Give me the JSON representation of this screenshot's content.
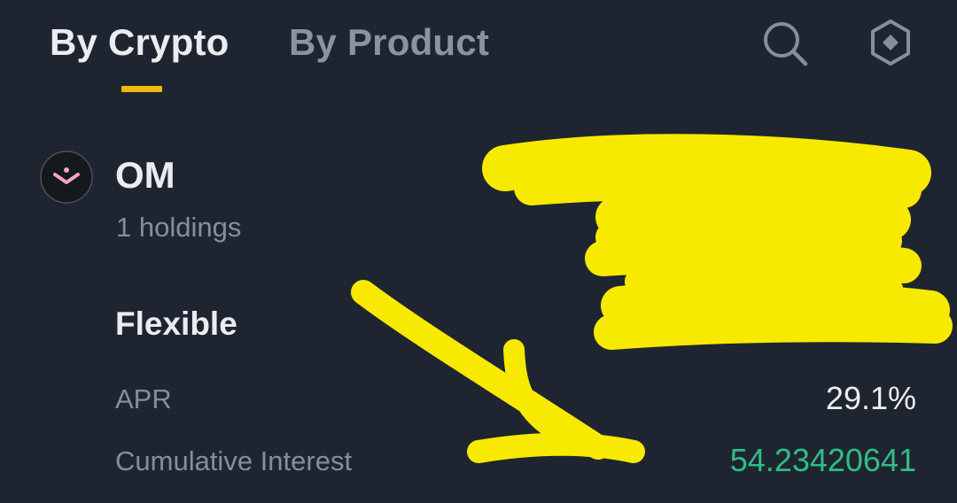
{
  "tabs": {
    "by_crypto": "By Crypto",
    "by_product": "By Product"
  },
  "icons": {
    "search": "search-icon",
    "settings": "hexagon-settings-icon",
    "coin_logo": "om-logo-icon"
  },
  "asset": {
    "symbol": "OM",
    "holdings": "1 holdings"
  },
  "product": {
    "section_title": "Flexible",
    "apr_label": "APR",
    "apr_value": "29.1%",
    "interest_label": "Cumulative Interest",
    "interest_value": "54.23420641"
  },
  "colors": {
    "background": "#1f2530",
    "accent": "#f0b90b",
    "positive": "#2ebd85",
    "highlight_marker": "#f7ea00"
  }
}
